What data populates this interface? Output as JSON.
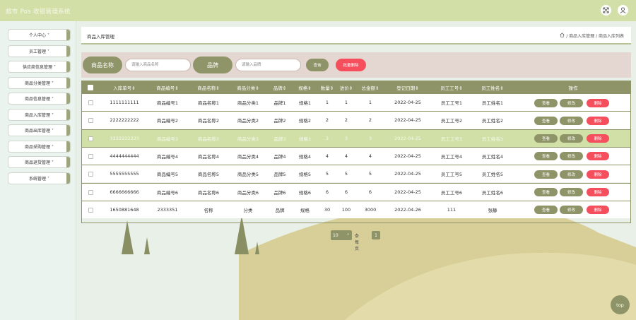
{
  "app": {
    "title": "超市 Pos 收银管理系统"
  },
  "topbar": {
    "icons": [
      "fullscreen-icon",
      "user-icon"
    ]
  },
  "sidebar": {
    "items": [
      {
        "label": "个人中心 ˅"
      },
      {
        "label": "员工管理 ˅"
      },
      {
        "label": "供应商信息管理 ˅"
      },
      {
        "label": "商品分类管理 ˅"
      },
      {
        "label": "商品信息管理 ˅"
      },
      {
        "label": "商品入库管理 ˅"
      },
      {
        "label": "商品出库管理 ˅"
      },
      {
        "label": "商品采购管理 ˅"
      },
      {
        "label": "商品退货管理 ˅"
      },
      {
        "label": "系统管理 ˅"
      }
    ]
  },
  "breadcrumb": {
    "title": "商品入库管理",
    "path": "/ 商品入库管理 / 商品入库列表"
  },
  "search": {
    "name_label": "商品名称",
    "name_placeholder": "请输入商品名称",
    "brand_label": "品牌",
    "brand_placeholder": "请输入品牌",
    "query_button": "查询",
    "batch_delete_button": "批量删除"
  },
  "table": {
    "headers": [
      "入库单号⇕",
      "商品编号⇕",
      "商品名称⇕",
      "商品分类⇕",
      "品牌⇕",
      "规格⇕",
      "数量⇕",
      "进价⇕",
      "总金额⇕",
      "登记日期⇕",
      "员工工号⇕",
      "员工姓名⇕",
      "操作"
    ],
    "actions": {
      "view": "查看",
      "edit": "修改",
      "delete": "删除"
    },
    "rows": [
      [
        "1111111111",
        "商品编号1",
        "商品名称1",
        "商品分类1",
        "品牌1",
        "规格1",
        "1",
        "1",
        "1",
        "2022-04-25",
        "员工工号1",
        "员工姓名1"
      ],
      [
        "2222222222",
        "商品编号2",
        "商品名称2",
        "商品分类2",
        "品牌2",
        "规格2",
        "2",
        "2",
        "2",
        "2022-04-25",
        "员工工号2",
        "员工姓名2"
      ],
      [
        "3333333333",
        "商品编号3",
        "商品名称3",
        "商品分类3",
        "品牌3",
        "规格3",
        "3",
        "3",
        "3",
        "2022-04-25",
        "员工工号3",
        "员工姓名3"
      ],
      [
        "4444444444",
        "商品编号4",
        "商品名称4",
        "商品分类4",
        "品牌4",
        "规格4",
        "4",
        "4",
        "4",
        "2022-04-25",
        "员工工号4",
        "员工姓名4"
      ],
      [
        "5555555555",
        "商品编号5",
        "商品名称5",
        "商品分类5",
        "品牌5",
        "规格5",
        "5",
        "5",
        "5",
        "2022-04-25",
        "员工工号5",
        "员工姓名5"
      ],
      [
        "6666666666",
        "商品编号6",
        "商品名称6",
        "商品分类6",
        "品牌6",
        "规格6",
        "6",
        "6",
        "6",
        "2022-04-25",
        "员工工号6",
        "员工姓名6"
      ],
      [
        "1650881648",
        "2333351",
        "名称",
        "分类",
        "品牌",
        "规格",
        "30",
        "100",
        "3000",
        "2022-04-26",
        "111",
        "张静"
      ]
    ]
  },
  "pagination": {
    "page_size": "10",
    "page_size_label": "条每页",
    "current_page": "1"
  },
  "back_to_top": "top",
  "colors": {
    "accent": "#8f9468",
    "topbar": "#d2e0a8",
    "selected_row": "#d0e0a6",
    "danger": "#f54f5e"
  }
}
